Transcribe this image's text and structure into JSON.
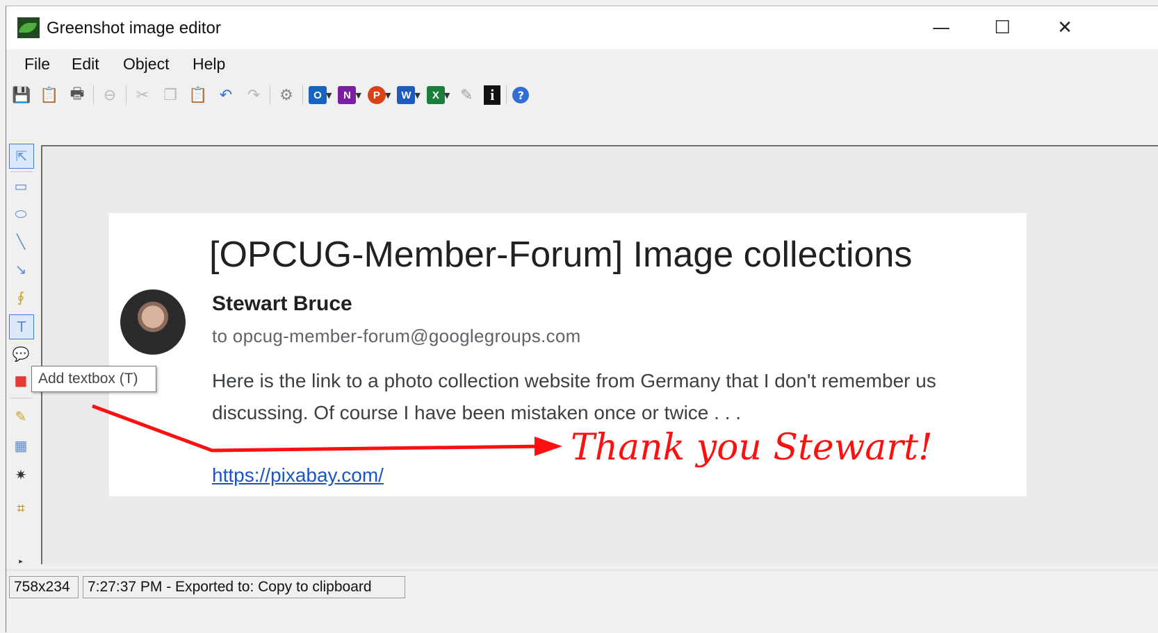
{
  "window": {
    "title": "Greenshot image editor",
    "controls": {
      "minimize": "—",
      "maximize": "☐",
      "close": "✕"
    }
  },
  "menu": [
    "File",
    "Edit",
    "Object",
    "Help"
  ],
  "toolbar": {
    "icons": [
      "save-icon",
      "copy-icon",
      "print-icon",
      "delete-icon",
      "cut-icon",
      "copy-object-icon",
      "paste-icon",
      "undo-icon",
      "redo-icon",
      "settings-icon",
      "outlook-icon",
      "onenote-icon",
      "powerpoint-icon",
      "word-icon",
      "excel-icon",
      "pen-icon",
      "info-icon",
      "help-icon"
    ],
    "office_letters": {
      "outlook": "O",
      "onenote": "N",
      "powerpoint": "P",
      "word": "W",
      "excel": "X"
    },
    "colors": {
      "outlook": "#1565c0",
      "onenote": "#7b1fa2",
      "powerpoint": "#d84315",
      "word": "#1e5bbf",
      "excel": "#1b7e3c",
      "help": "#2f6fd6"
    }
  },
  "left_tools": [
    "select-icon",
    "rectangle-icon",
    "ellipse-icon",
    "line-icon",
    "arrow-icon",
    "freehand-icon",
    "textbox-icon",
    "speechbubble-icon",
    "stepcounter-icon",
    "highlight-icon",
    "obfuscate-icon",
    "effects-icon",
    "crop-icon"
  ],
  "tooltip": "Add textbox (T)",
  "email": {
    "subject": "[OPCUG-Member-Forum] Image collections",
    "sender": "Stewart Bruce",
    "recipient": "to opcug-member-forum@googlegroups.com",
    "body_line1": "Here is the link to a photo collection website from Germany that I don't remember us",
    "body_line2": "discussing.  Of course I have been mistaken once or twice . . .",
    "link": "https://pixabay.com/"
  },
  "annotation": {
    "text": "Thank you Stewart!",
    "color": "#ff1010"
  },
  "status": {
    "dimensions": "758x234",
    "message": "7:27:37 PM - Exported to: Copy to clipboard"
  }
}
